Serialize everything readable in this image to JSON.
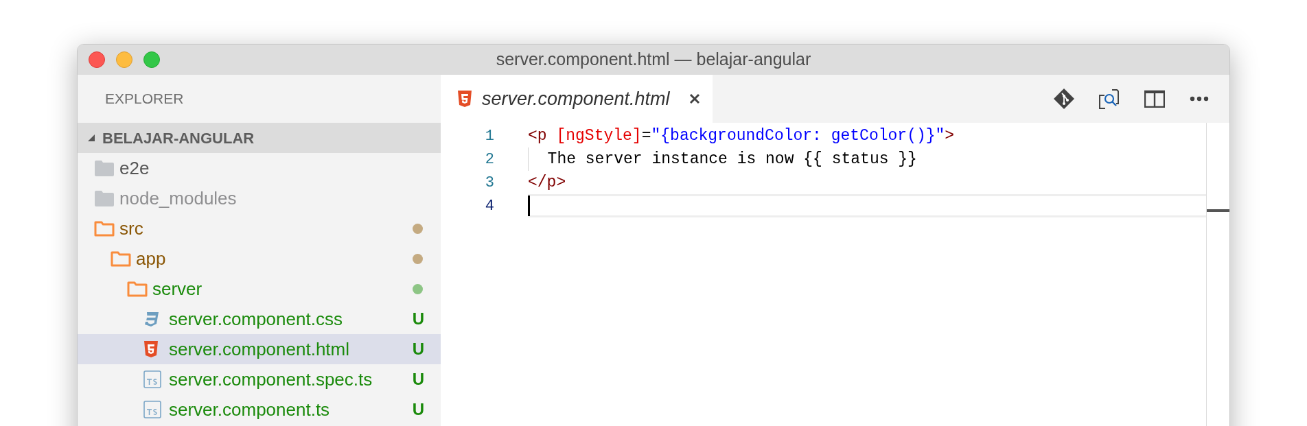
{
  "window": {
    "title": "server.component.html — belajar-angular"
  },
  "sidebar": {
    "title": "EXPLORER",
    "section": {
      "title": "BELAJAR-ANGULAR",
      "expanded": true
    },
    "tree": [
      {
        "name": "e2e",
        "kind": "folder",
        "expanded": false,
        "color": "#555555",
        "dot": false,
        "selected": false
      },
      {
        "name": "node_modules",
        "kind": "folder",
        "expanded": false,
        "color": "#8e8e90",
        "dot": false,
        "selected": false
      },
      {
        "name": "src",
        "kind": "folder",
        "expanded": true,
        "color": "#895503",
        "dot": true,
        "selected": false,
        "children": [
          {
            "name": "app",
            "kind": "folder",
            "expanded": true,
            "color": "#895503",
            "dot": true,
            "selected": false,
            "children": [
              {
                "name": "server",
                "kind": "folder",
                "expanded": true,
                "color": "#1a8a0b",
                "dot": true,
                "selected": false,
                "children": [
                  {
                    "name": "server.component.css",
                    "kind": "css",
                    "color": "#1a8a0b",
                    "badge": "U",
                    "selected": false
                  },
                  {
                    "name": "server.component.html",
                    "kind": "html",
                    "color": "#1a8a0b",
                    "badge": "U",
                    "selected": true
                  },
                  {
                    "name": "server.component.spec.ts",
                    "kind": "ts",
                    "color": "#1a8a0b",
                    "badge": "U",
                    "selected": false
                  },
                  {
                    "name": "server.component.ts",
                    "kind": "ts",
                    "color": "#1a8a0b",
                    "badge": "U",
                    "selected": false
                  }
                ]
              }
            ]
          }
        ]
      }
    ]
  },
  "editor": {
    "tabs": [
      {
        "label": "server.component.html",
        "kind": "html",
        "selected": true,
        "preview": true
      }
    ],
    "lines": [
      {
        "number": "1",
        "active": false,
        "tokens": [
          {
            "kind": "tag",
            "text": "<p "
          },
          {
            "kind": "attr",
            "text": "[ngStyle]"
          },
          {
            "kind": "plain",
            "text": "="
          },
          {
            "kind": "string",
            "text": "\"{backgroundColor: getColor()}\""
          },
          {
            "kind": "tag",
            "text": ">"
          }
        ]
      },
      {
        "number": "2",
        "indent_guide": true,
        "active": false,
        "tokens": [
          {
            "kind": "plain",
            "text": "  The server instance is now {{ status }}"
          }
        ]
      },
      {
        "number": "3",
        "active": false,
        "tokens": [
          {
            "kind": "tag",
            "text": "</p>"
          }
        ]
      },
      {
        "number": "4",
        "active": true
      }
    ]
  }
}
